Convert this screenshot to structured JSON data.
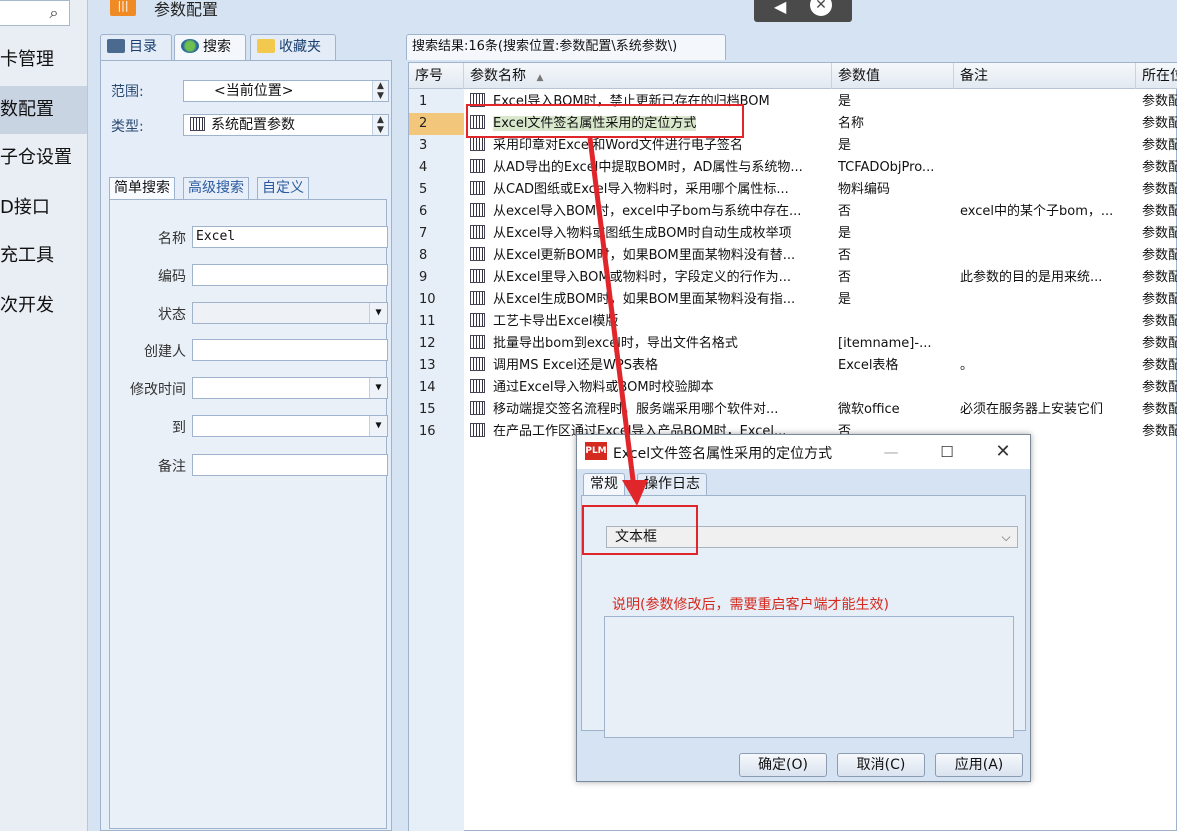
{
  "left_nav": {
    "search_icon": "search-icon",
    "items": [
      {
        "label": "卡管理",
        "active": false
      },
      {
        "label": "数配置",
        "active": true
      },
      {
        "label": "子仓设置",
        "active": false
      },
      {
        "label": "D接口",
        "active": false
      },
      {
        "label": "充工具",
        "active": false
      },
      {
        "label": "次开发",
        "active": false
      }
    ]
  },
  "header": {
    "title": "参数配置",
    "icon": "settings-sliders-icon",
    "float_controls": {
      "back": "◀",
      "close": "✕"
    }
  },
  "search_panel": {
    "tabs": [
      {
        "label": "目录",
        "icon": "directory-icon"
      },
      {
        "label": "搜索",
        "icon": "search-globe-icon"
      },
      {
        "label": "收藏夹",
        "icon": "favorites-icon"
      }
    ],
    "scope_label": "范围:",
    "scope_value": "<当前位置>",
    "type_label": "类型:",
    "type_value": "系统配置参数",
    "search_tabs": [
      "简单搜索",
      "高级搜索",
      "自定义"
    ],
    "fields": {
      "name": {
        "label": "名称",
        "value": "Excel"
      },
      "code": {
        "label": "编码",
        "value": ""
      },
      "status": {
        "label": "状态",
        "value": ""
      },
      "creator": {
        "label": "创建人",
        "value": ""
      },
      "modified": {
        "label": "修改时间",
        "value": ""
      },
      "to": {
        "label": "到",
        "value": ""
      },
      "note": {
        "label": "备注",
        "value": ""
      }
    }
  },
  "results": {
    "tab_label": "搜索结果:16条(搜索位置:参数配置\\系统参数\\)",
    "columns": [
      "序号",
      "参数名称",
      "参数值",
      "备注",
      "所在位置"
    ],
    "sort_indicator": "▲",
    "rows": [
      {
        "seq": "1",
        "name": "Excel导入BOM时，禁止更新已存在的归档BOM",
        "value": "是",
        "note": "",
        "loc": "参数配"
      },
      {
        "seq": "2",
        "name": "Excel文件签名属性采用的定位方式",
        "value": "名称",
        "note": "",
        "loc": "参数配"
      },
      {
        "seq": "3",
        "name": "采用印章对Excel和Word文件进行电子签名",
        "value": "是",
        "note": "",
        "loc": "参数配"
      },
      {
        "seq": "4",
        "name": "从AD导出的Excel中提取BOM时，AD属性与系统物...",
        "value": "TCFADObjPro...",
        "note": "",
        "loc": "参数配"
      },
      {
        "seq": "5",
        "name": "从CAD图纸或Excel导入物料时，采用哪个属性标...",
        "value": "物料编码",
        "note": "",
        "loc": "参数配"
      },
      {
        "seq": "6",
        "name": "从excel导入BOM时，excel中子bom与系统中存在...",
        "value": "否",
        "note": "excel中的某个子bom，...",
        "loc": "参数配"
      },
      {
        "seq": "7",
        "name": "从Excel导入物料或图纸生成BOM时自动生成枚举项",
        "value": "是",
        "note": "",
        "loc": "参数配"
      },
      {
        "seq": "8",
        "name": "从Excel更新BOM时，如果BOM里面某物料没有替...",
        "value": "否",
        "note": "",
        "loc": "参数配"
      },
      {
        "seq": "9",
        "name": "从Excel里导入BOM或物料时，字段定义的行作为...",
        "value": "否",
        "note": "此参数的目的是用来统...",
        "loc": "参数配"
      },
      {
        "seq": "10",
        "name": "从Excel生成BOM时，如果BOM里面某物料没有指...",
        "value": "是",
        "note": "",
        "loc": "参数配"
      },
      {
        "seq": "11",
        "name": "工艺卡导出Excel模版",
        "value": "",
        "note": "",
        "loc": "参数配"
      },
      {
        "seq": "12",
        "name": "批量导出bom到excel时，导出文件名格式",
        "value": "[itemname]-...",
        "note": "",
        "loc": "参数配"
      },
      {
        "seq": "13",
        "name": "调用MS Excel还是WPS表格",
        "value": "Excel表格",
        "note": "。",
        "loc": "参数配"
      },
      {
        "seq": "14",
        "name": "通过Excel导入物料或BOM时校验脚本",
        "value": "",
        "note": "",
        "loc": "参数配"
      },
      {
        "seq": "15",
        "name": "移动端提交签名流程时，服务端采用哪个软件对...",
        "value": "微软office",
        "note": "必须在服务器上安装它们",
        "loc": "参数配"
      },
      {
        "seq": "16",
        "name": "在产品工作区通过Excel导入产品BOM时，Excel...",
        "value": "否",
        "note": "",
        "loc": "参数配"
      }
    ],
    "selected_index": 1
  },
  "dialog": {
    "icon_text": "PLM",
    "title": "Excel文件签名属性采用的定位方式",
    "window_buttons": {
      "minimize": "—",
      "maximize": "☐",
      "close": "✕"
    },
    "tabs": [
      "常规",
      "操作日志"
    ],
    "select_value": "文本框",
    "desc_label": "说明(参数修改后，需要重启客户端才能生效)",
    "desc_text": "",
    "buttons": {
      "ok": "确定(O)",
      "cancel": "取消(C)",
      "apply": "应用(A)"
    }
  },
  "colors": {
    "annotation": "#e0262a",
    "selected_row": "#d9e7cc",
    "panel_bg": "#d6e3f2"
  }
}
